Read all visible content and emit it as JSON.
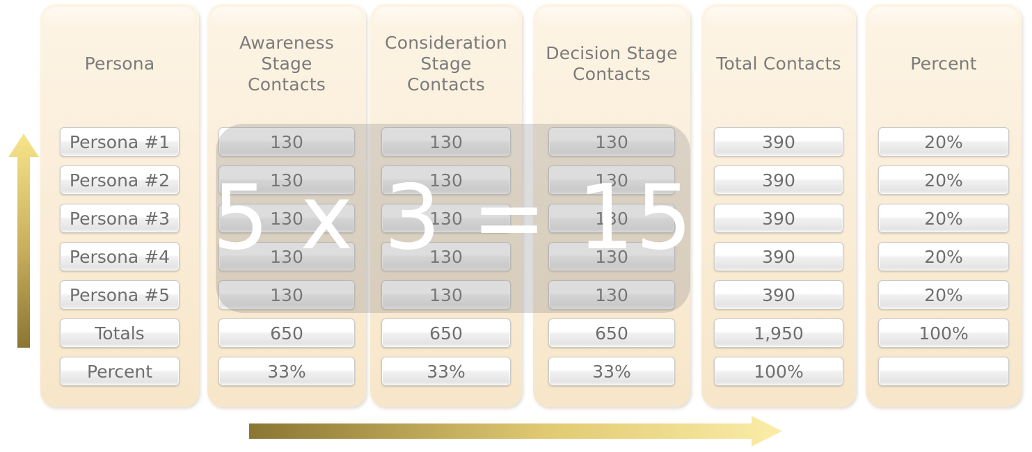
{
  "diagram": {
    "title_equation": "5 x 3 = 15",
    "columns": [
      {
        "header": "Persona",
        "key": "persona"
      },
      {
        "header": "Awareness\nStage\nContacts",
        "key": "awareness"
      },
      {
        "header": "Consideration\nStage\nContacts",
        "key": "consideration"
      },
      {
        "header": "Decision Stage\nContacts",
        "key": "decision"
      },
      {
        "header": "Total Contacts",
        "key": "total"
      },
      {
        "header": "Percent",
        "key": "percent"
      }
    ],
    "rows": [
      {
        "persona": "Persona #1",
        "awareness": "130",
        "consideration": "130",
        "decision": "130",
        "total": "390",
        "percent": "20%"
      },
      {
        "persona": "Persona #2",
        "awareness": "130",
        "consideration": "130",
        "decision": "130",
        "total": "390",
        "percent": "20%"
      },
      {
        "persona": "Persona #3",
        "awareness": "130",
        "consideration": "130",
        "decision": "130",
        "total": "390",
        "percent": "20%"
      },
      {
        "persona": "Persona #4",
        "awareness": "130",
        "consideration": "130",
        "decision": "130",
        "total": "390",
        "percent": "20%"
      },
      {
        "persona": "Persona #5",
        "awareness": "130",
        "consideration": "130",
        "decision": "130",
        "total": "390",
        "percent": "20%"
      },
      {
        "persona": "Totals",
        "awareness": "650",
        "consideration": "650",
        "decision": "650",
        "total": "1,950",
        "percent": "100%"
      },
      {
        "persona": "Percent",
        "awareness": "33%",
        "consideration": "33%",
        "decision": "33%",
        "total": "100%",
        "percent": ""
      }
    ],
    "arrows": {
      "vertical": {
        "direction": "up",
        "gradient_from": "#f7e58a",
        "gradient_to": "#8a7533"
      },
      "horizontal": {
        "direction": "right",
        "gradient_from": "#8a7533",
        "gradient_to": "#f9e9a0"
      }
    },
    "colors": {
      "panel_fill": "#fbefdc",
      "cell_text": "#6e6e6e",
      "header_text": "#7b7b7b",
      "overlay_tint": "#8e8e8e",
      "overlay_text": "#ffffff",
      "page_background": "#ffffff"
    }
  }
}
